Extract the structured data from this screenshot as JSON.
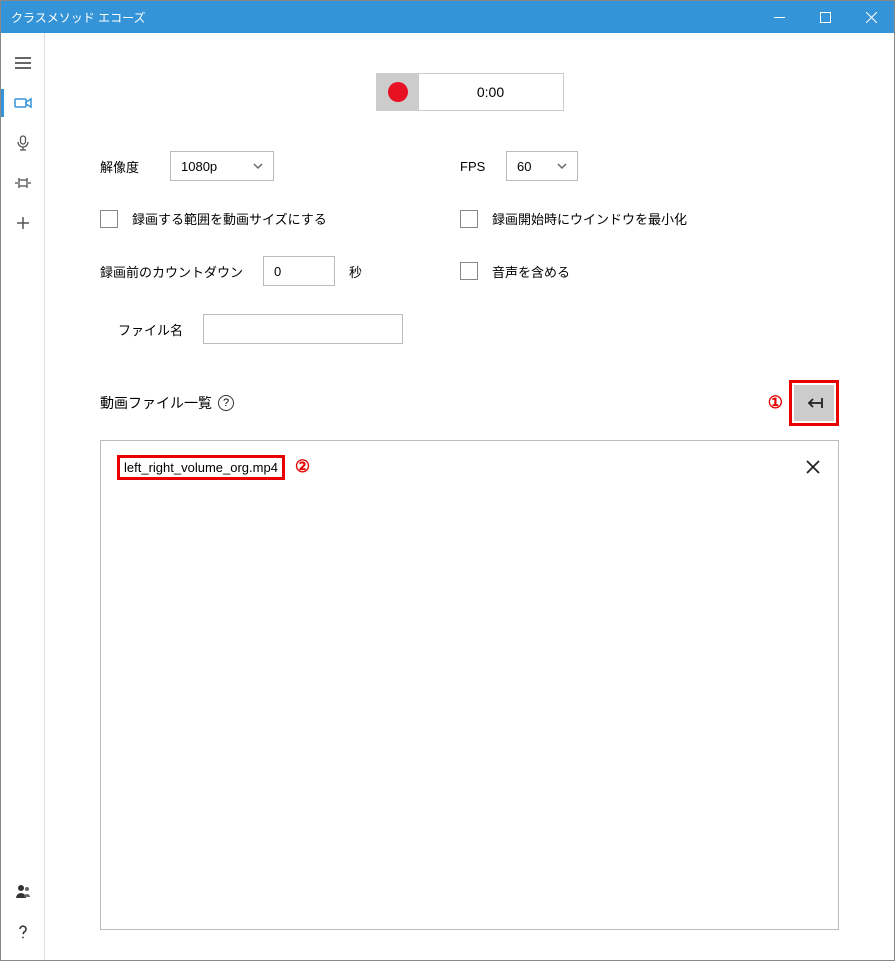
{
  "titlebar": {
    "title": "クラスメソッド エコーズ"
  },
  "record": {
    "time": "0:00"
  },
  "resolution": {
    "label": "解像度",
    "value": "1080p"
  },
  "fps": {
    "label": "FPS",
    "value": "60"
  },
  "check_fit": {
    "label": "録画する範囲を動画サイズにする"
  },
  "check_minimize": {
    "label": "録画開始時にウインドウを最小化"
  },
  "countdown": {
    "label": "録画前のカウントダウン",
    "value": "0",
    "unit": "秒"
  },
  "check_audio": {
    "label": "音声を含める"
  },
  "filename": {
    "label": "ファイル名",
    "value": ""
  },
  "filelist": {
    "header": "動画ファイル一覧",
    "help": "?",
    "items": [
      "left_right_volume_org.mp4"
    ]
  },
  "annotations": {
    "a1": "①",
    "a2": "②"
  }
}
